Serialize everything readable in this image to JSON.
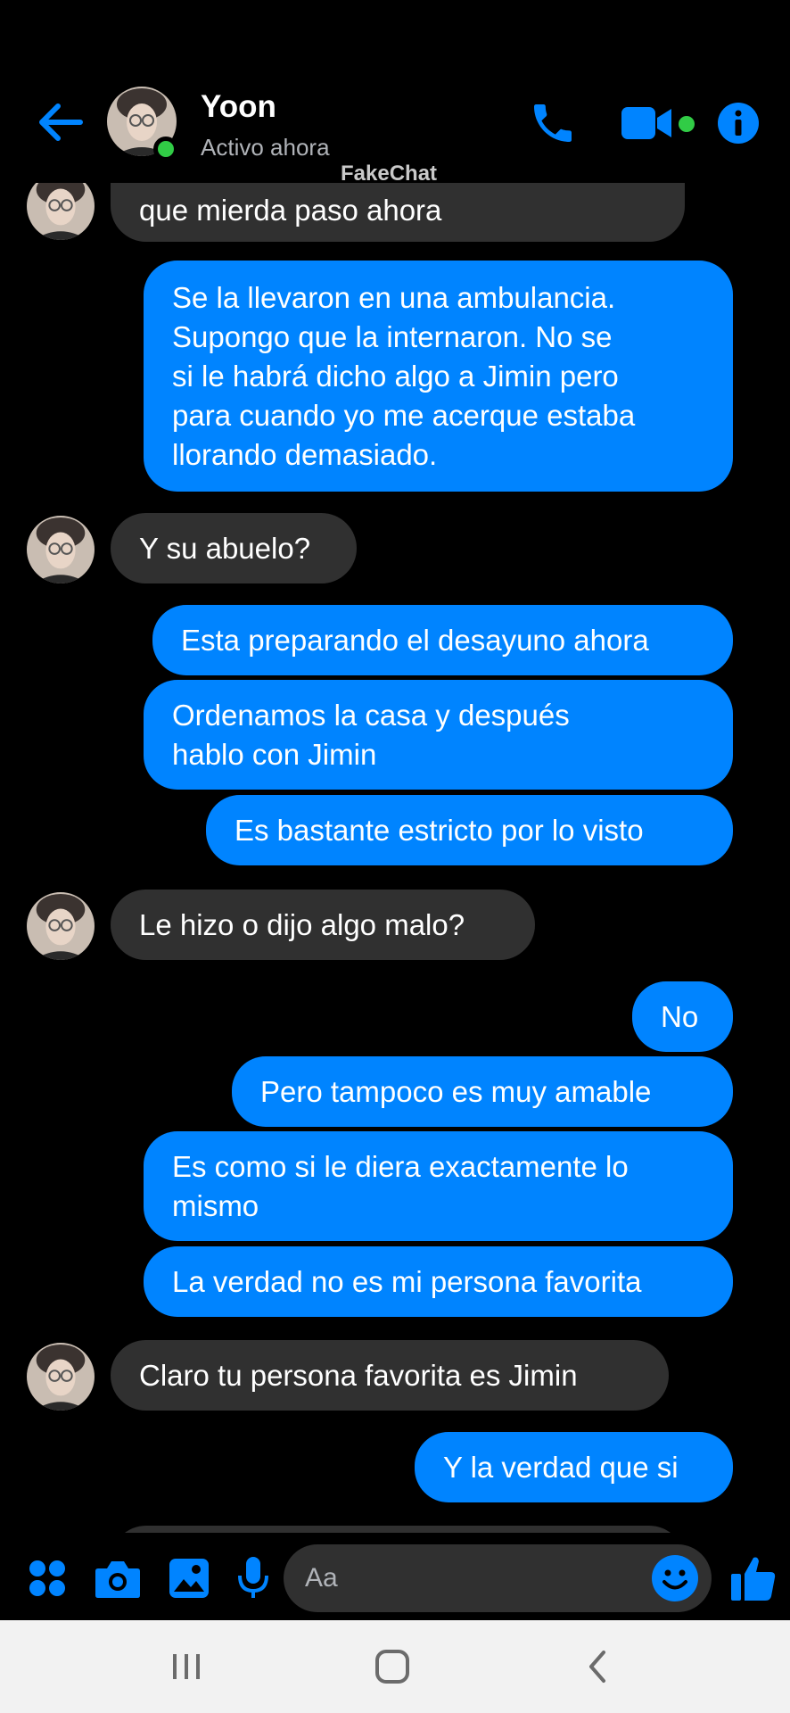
{
  "header": {
    "contact_name": "Yoon",
    "status": "Activo ahora",
    "watermark": "FakeChat",
    "icons": [
      "back-arrow-icon",
      "phone-icon",
      "video-camera-icon",
      "info-icon"
    ]
  },
  "messages": [
    {
      "side": "in",
      "text": "que mierda paso ahora"
    },
    {
      "side": "out",
      "text": "Se la llevaron en una ambulancia.\nSupongo que la internaron. No se\nsi le habrá dicho algo a Jimin pero\npara cuando yo me acerque estaba\nllorando demasiado."
    },
    {
      "side": "in",
      "text": "Y su abuelo?"
    },
    {
      "side": "out",
      "text": "Esta preparando el desayuno ahora"
    },
    {
      "side": "out",
      "text": "Ordenamos la casa y después\nhablo con Jimin"
    },
    {
      "side": "out",
      "text": "Es bastante estricto por lo visto"
    },
    {
      "side": "in",
      "text": "Le hizo o dijo algo malo?"
    },
    {
      "side": "out",
      "text": "No"
    },
    {
      "side": "out",
      "text": "Pero tampoco es muy amable"
    },
    {
      "side": "out",
      "text": "Es como si le diera exactamente lo\nmismo"
    },
    {
      "side": "out",
      "text": "La verdad no es mi persona favorita"
    },
    {
      "side": "in",
      "text": "Claro tu persona favorita es Jimin"
    },
    {
      "side": "out",
      "text": "Y la verdad que si"
    }
  ],
  "composer": {
    "placeholder": "Aa",
    "icons": [
      "apps-icon",
      "camera-icon",
      "gallery-icon",
      "microphone-icon",
      "emoji-icon",
      "like-icon"
    ]
  },
  "colors": {
    "accent": "#0084ff",
    "incoming_bubble": "#303030",
    "online": "#31cc46",
    "background": "#000000"
  }
}
